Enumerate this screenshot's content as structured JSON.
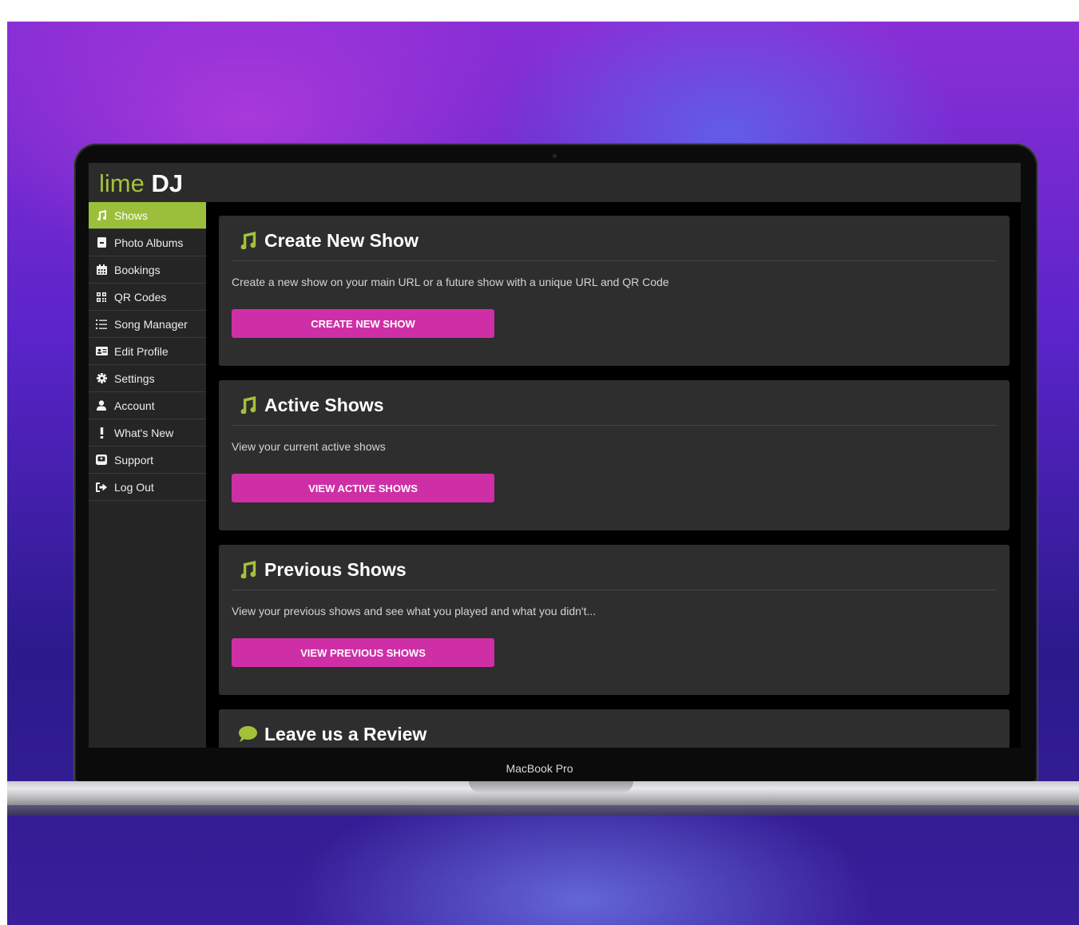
{
  "device": {
    "label": "MacBook Pro"
  },
  "app": {
    "logo_primary": "lime",
    "logo_secondary": "DJ"
  },
  "sidebar": {
    "items": [
      {
        "label": "Shows",
        "icon": "music-note-icon",
        "active": true
      },
      {
        "label": "Photo Albums",
        "icon": "photo-album-icon"
      },
      {
        "label": "Bookings",
        "icon": "calendar-icon"
      },
      {
        "label": "QR Codes",
        "icon": "qr-code-icon"
      },
      {
        "label": "Song Manager",
        "icon": "list-icon"
      },
      {
        "label": "Edit Profile",
        "icon": "id-card-icon"
      },
      {
        "label": "Settings",
        "icon": "gear-icon"
      },
      {
        "label": "Account",
        "icon": "user-icon"
      },
      {
        "label": "What's New",
        "icon": "exclamation-icon"
      },
      {
        "label": "Support",
        "icon": "support-icon"
      },
      {
        "label": "Log Out",
        "icon": "logout-icon"
      }
    ]
  },
  "cards": [
    {
      "title": "Create New Show",
      "icon": "music-note-icon",
      "description": "Create a new show on your main URL or a future show with a unique URL and QR Code",
      "button": "CREATE NEW SHOW"
    },
    {
      "title": "Active Shows",
      "icon": "music-note-icon",
      "description": "View your current active shows",
      "button": "VIEW ACTIVE SHOWS"
    },
    {
      "title": "Previous Shows",
      "icon": "music-note-icon",
      "description": "View your previous shows and see what you played and what you didn't...",
      "button": "VIEW PREVIOUS SHOWS"
    },
    {
      "title": "Leave us a Review",
      "icon": "chat-bubble-icon"
    }
  ],
  "colors": {
    "accent_green": "#9bbf3a",
    "button_magenta": "#cf2fa6",
    "panel_bg": "#2e2e2e",
    "sidebar_bg": "#252525"
  }
}
